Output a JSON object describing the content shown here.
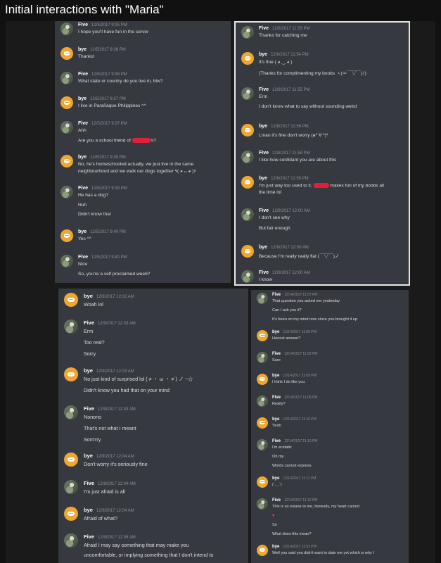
{
  "post_title": "Initial interactions with \"Maria\"",
  "shot_a": {
    "m1": {
      "name": "Five",
      "time": "12/5/2017 9:35 PM",
      "l1": "I hope you'll have fun in the server"
    },
    "m2": {
      "name": "bye",
      "time": "12/5/2017 9:36 PM",
      "l1": "Thanks!"
    },
    "m3": {
      "name": "Five",
      "time": "12/5/2017 9:36 PM",
      "l1": "What state or country do you live in, btw?"
    },
    "m4": {
      "name": "bye",
      "time": "12/5/2017 9:37 PM",
      "l1": "I live in Parañaque Philippines ^^"
    },
    "m5": {
      "name": "Five",
      "time": "12/5/2017 9:37 PM",
      "l1": "Ahh",
      "l2a": "Are you a school friend of ",
      "l2b": "'s?"
    },
    "m6": {
      "name": "bye",
      "time": "12/5/2017 9:39 PM",
      "l1": "No, he's homeschooled actually, we just live in the same",
      "l2": "neighbourhood and we walk our dogs together ٩( ◕ ᴗ ◕ )۶"
    },
    "m7": {
      "name": "Five",
      "time": "12/5/2017 9:39 PM",
      "l1": "He has a dog?",
      "l2": "Huh",
      "l3": "Didn't know that"
    },
    "m8": {
      "name": "bye",
      "time": "12/5/2017 9:40 PM",
      "l1": "Yes ^^"
    },
    "m9": {
      "name": "Five",
      "time": "12/5/2017 9:40 PM",
      "l1": "Nice",
      "l2": "So, you're a self proclaimed weeb?"
    }
  },
  "shot_b": {
    "m1": {
      "name": "Five",
      "time": "12/8/2017 11:53 PM",
      "l1": "Thanks for catching me"
    },
    "m2": {
      "name": "bye",
      "time": "12/8/2017 11:54 PM",
      "l1": "It's fine ( ◕ ‿ ◕ )",
      "l2": "(Thanks for complimenting my boobs ヽ(＝￣▽￣)ﾉ)"
    },
    "m3": {
      "name": "Five",
      "time": "12/8/2017 11:55 PM",
      "l1": "Erm",
      "l2": "I don't know what to say without sounding weird"
    },
    "m4": {
      "name": "bye",
      "time": "12/8/2017 11:56 PM",
      "l1": "Lmao it's fine don't worry (๑º ∀ º)*"
    },
    "m5": {
      "name": "Five",
      "time": "12/8/2017 11:59 PM",
      "l1": "I like how confidant you are about this"
    },
    "m6": {
      "name": "bye",
      "time": "12/8/2017 11:59 PM",
      "l1a": "I'm just way too used to it, ",
      "l1b": " makes fun of my boobs all",
      "l2": "the time lol"
    },
    "m7": {
      "name": "Five",
      "time": "12/9/2017 12:00 AM",
      "l1": "I don't see why",
      "l2": "But fair enough"
    },
    "m8": {
      "name": "bye",
      "time": "12/9/2017 12:00 AM",
      "l1": "Because I'm really really flat (￣▽￣)ノ"
    },
    "m9": {
      "name": "Five",
      "time": "12/9/2017 12:00 AM",
      "l1": "I know"
    }
  },
  "shot_c": {
    "m1": {
      "name": "bye",
      "time": "12/9/2017 12:02 AM",
      "l1": "Woah lol"
    },
    "m2": {
      "name": "Five",
      "time": "12/9/2017 12:03 AM",
      "l1": "Erm",
      "l2": "Too real?",
      "l3": "Sorry"
    },
    "m3": {
      "name": "bye",
      "time": "12/9/2017 12:03 AM",
      "l1": "No just kind of surprised lol ( ≠ ・ ω ・ ≠ ) ノ ~☆",
      "l2": "Didn't know you had that on your mind"
    },
    "m4": {
      "name": "Five",
      "time": "12/9/2017 12:03 AM",
      "l1": "Nonono",
      "l2": "That's not what I meant",
      "l3": "Sorrrrry"
    },
    "m5": {
      "name": "bye",
      "time": "12/9/2017 12:04 AM",
      "l1": "Don't worry it's seriously fine"
    },
    "m6": {
      "name": "Five",
      "time": "12/9/2017 12:04 AM",
      "l1": "I'm just afraid is all"
    },
    "m7": {
      "name": "bye",
      "time": "12/9/2017 12:04 AM",
      "l1": "Afraid of what?"
    },
    "m8": {
      "name": "Five",
      "time": "12/9/2017 12:05 AM",
      "l1": "Afraid I may say something that may make you",
      "l2": "uncomfortable, or implying something that I don't intend to"
    }
  },
  "shot_d": {
    "m1": {
      "name": "Five",
      "time": "12/14/2017 11:07 PM",
      "l1": "That question you asked me yesterday",
      "l2": "Can I ask you it?",
      "l3": "It's been on my mind now since you brought it up"
    },
    "m2": {
      "name": "bye",
      "time": "12/14/2017 11:09 PM",
      "l1": "Honest answer?"
    },
    "m3": {
      "name": "Five",
      "time": "12/14/2017 11:09 PM",
      "l1": "Sure"
    },
    "m4": {
      "name": "bye",
      "time": "12/14/2017 11:09 PM",
      "l1": "I think I do like you"
    },
    "m5": {
      "name": "Five",
      "time": "12/14/2017 11:09 PM",
      "l1": "Really?"
    },
    "m6": {
      "name": "bye",
      "time": "12/14/2017 11:10 PM",
      "l1": "Yeah"
    },
    "m7": {
      "name": "Five",
      "time": "12/14/2017 11:10 PM",
      "l1": "I'm ecstatic",
      "l2": "Oh my",
      "l3": "Words cannot express"
    },
    "m8": {
      "name": "bye",
      "time": "12/14/2017 11:11 PM",
      "l1": "(´. ̫ .`)"
    },
    "m9": {
      "name": "Five",
      "time": "12/14/2017 11:12 PM",
      "l1": "This is so insane to me, honestly, my heart cannot",
      "l2": "♥",
      "l3": "So",
      "l4": "What does this mean?"
    },
    "m10": {
      "name": "bye",
      "time": "12/14/2017 11:51 PM",
      "l1": "Well you said you didn't want to date me yet which is why I"
    }
  },
  "colors": {
    "bye_avatar": "#f0a732",
    "redaction": "#e0203a",
    "heart": "#ff3b6b",
    "chat_bg": "#36393f"
  },
  "icons": {
    "bye_avatar": "discord-logo-icon",
    "five_avatar": "anime-avatar-icon"
  }
}
